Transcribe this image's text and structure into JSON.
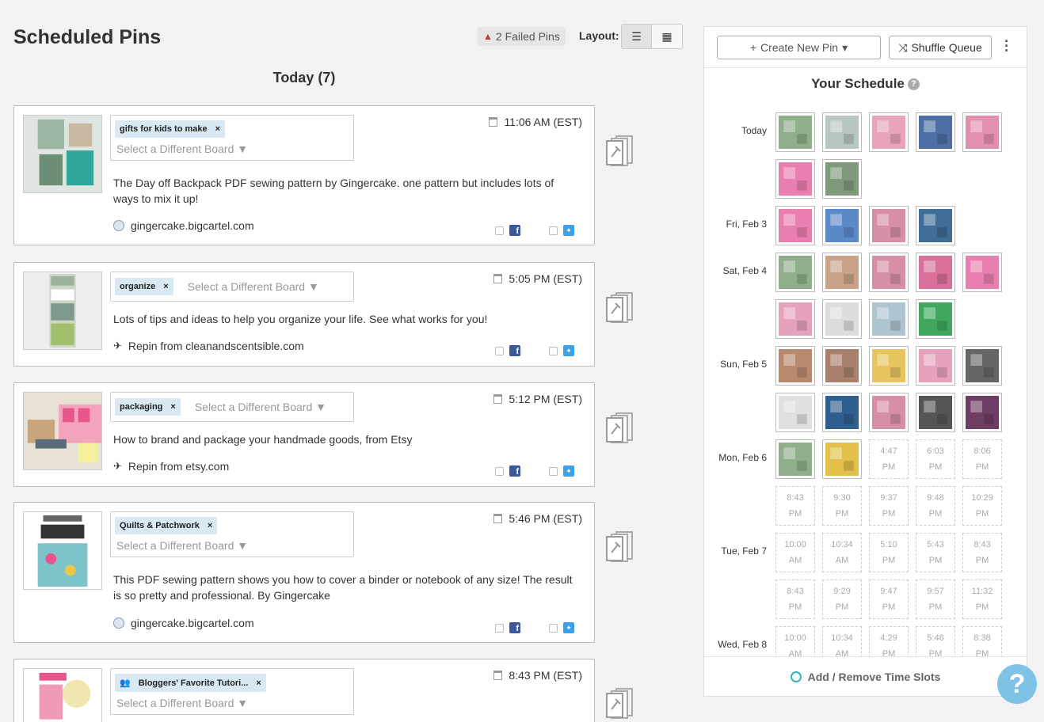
{
  "header": {
    "title": "Scheduled Pins",
    "failed_pins": "2 Failed Pins",
    "layout_label": "Layout:",
    "day_heading": "Today (7)"
  },
  "pins": [
    {
      "board": "gifts for kids to make",
      "board_select": "Select a Different Board ▼",
      "time": "11:06 AM (EST)",
      "description": "The Day off Backpack PDF sewing pattern by Gingercake.  one pattern but includes lots of ways to mix it up!",
      "source": "gingercake.bigcartel.com",
      "source_type": "web"
    },
    {
      "board": "organize",
      "board_select": "Select a Different Board ▼",
      "time": "5:05 PM (EST)",
      "description": "Lots of tips and ideas to help you organize your life. See what works for you!",
      "source": "Repin from cleanandscentsible.com",
      "source_type": "repin"
    },
    {
      "board": "packaging",
      "board_select": "Select a Different Board ▼",
      "time": "5:12 PM (EST)",
      "description": "How to brand and package your handmade goods, from Etsy",
      "source": "Repin from etsy.com",
      "source_type": "repin"
    },
    {
      "board": "Quilts & Patchwork",
      "board_select": "Select a Different Board ▼",
      "time": "5:46 PM (EST)",
      "description": "This PDF sewing pattern shows you how to cover a binder or notebook of any size!  The result is so pretty and professional.  By Gingercake",
      "source": "gingercake.bigcartel.com",
      "source_type": "web"
    },
    {
      "board": "Bloggers' Favorite Tutori...",
      "board_select": "Select a Different Board ▼",
      "time": "8:43 PM (EST)",
      "description": "",
      "source": "",
      "source_type": "none"
    }
  ],
  "panel": {
    "create_label": "Create New Pin",
    "shuffle_label": "Shuffle Queue",
    "schedule_title": "Your Schedule",
    "footer_label": "Add / Remove Time Slots",
    "days": [
      {
        "label": "Today",
        "rows": [
          [
            {
              "t": "img",
              "c": "#8fae8a"
            },
            {
              "t": "img",
              "c": "#b8c7c0"
            },
            {
              "t": "img",
              "c": "#e8a4b8"
            },
            {
              "t": "img",
              "c": "#4d6fa3"
            },
            {
              "t": "img",
              "c": "#e38fb0"
            }
          ],
          [
            {
              "t": "img",
              "c": "#e97fb0"
            },
            {
              "t": "img",
              "c": "#7f9a7a"
            }
          ]
        ]
      },
      {
        "label": "Fri, Feb 3",
        "rows": [
          [
            {
              "t": "img",
              "c": "#e97fb0"
            },
            {
              "t": "img",
              "c": "#5b8ac9"
            },
            {
              "t": "img",
              "c": "#d68fa4"
            },
            {
              "t": "img",
              "c": "#3e6d95"
            }
          ]
        ]
      },
      {
        "label": "Sat, Feb 4",
        "rows": [
          [
            {
              "t": "img",
              "c": "#8fae8a"
            },
            {
              "t": "img",
              "c": "#c9a28a"
            },
            {
              "t": "img",
              "c": "#d68fa4"
            },
            {
              "t": "img",
              "c": "#d8709a"
            },
            {
              "t": "img",
              "c": "#e97fb0"
            }
          ],
          [
            {
              "t": "img",
              "c": "#e6a2bd"
            },
            {
              "t": "img",
              "c": "#dddddd"
            },
            {
              "t": "img",
              "c": "#aec4cf"
            },
            {
              "t": "img",
              "c": "#3fa85c"
            }
          ]
        ]
      },
      {
        "label": "Sun, Feb 5",
        "rows": [
          [
            {
              "t": "img",
              "c": "#b9896e"
            },
            {
              "t": "img",
              "c": "#a8806b"
            },
            {
              "t": "img",
              "c": "#e7c45f"
            },
            {
              "t": "img",
              "c": "#e6a2bd"
            },
            {
              "t": "img",
              "c": "#666666"
            }
          ],
          [
            {
              "t": "img",
              "c": "#e0e0e0"
            },
            {
              "t": "img",
              "c": "#2f5f8f"
            },
            {
              "t": "img",
              "c": "#d68fa4"
            },
            {
              "t": "img",
              "c": "#555555"
            },
            {
              "t": "img",
              "c": "#6e3d63"
            }
          ]
        ]
      },
      {
        "label": "Mon, Feb 6",
        "rows": [
          [
            {
              "t": "img",
              "c": "#8fae8a"
            },
            {
              "t": "img",
              "c": "#e3c04a"
            },
            {
              "t": "slot",
              "a": "4:47",
              "b": "PM"
            },
            {
              "t": "slot",
              "a": "6:03",
              "b": "PM"
            },
            {
              "t": "slot",
              "a": "8:06",
              "b": "PM"
            }
          ],
          [
            {
              "t": "slot",
              "a": "8:43",
              "b": "PM"
            },
            {
              "t": "slot",
              "a": "9:30",
              "b": "PM"
            },
            {
              "t": "slot",
              "a": "9:37",
              "b": "PM"
            },
            {
              "t": "slot",
              "a": "9:48",
              "b": "PM"
            },
            {
              "t": "slot",
              "a": "10:29",
              "b": "PM"
            }
          ]
        ]
      },
      {
        "label": "Tue, Feb 7",
        "rows": [
          [
            {
              "t": "slot",
              "a": "10:00",
              "b": "AM"
            },
            {
              "t": "slot",
              "a": "10:34",
              "b": "AM"
            },
            {
              "t": "slot",
              "a": "5:10",
              "b": "PM"
            },
            {
              "t": "slot",
              "a": "5:43",
              "b": "PM"
            },
            {
              "t": "slot",
              "a": "8:43",
              "b": "PM"
            }
          ],
          [
            {
              "t": "slot",
              "a": "8:43",
              "b": "PM"
            },
            {
              "t": "slot",
              "a": "9:29",
              "b": "PM"
            },
            {
              "t": "slot",
              "a": "9:47",
              "b": "PM"
            },
            {
              "t": "slot",
              "a": "9:57",
              "b": "PM"
            },
            {
              "t": "slot",
              "a": "11:32",
              "b": "PM"
            }
          ]
        ]
      },
      {
        "label": "Wed, Feb 8",
        "rows": [
          [
            {
              "t": "slot",
              "a": "10:00",
              "b": "AM"
            },
            {
              "t": "slot",
              "a": "10:34",
              "b": "AM"
            },
            {
              "t": "slot",
              "a": "4:29",
              "b": "PM"
            },
            {
              "t": "slot",
              "a": "5:46",
              "b": "PM"
            },
            {
              "t": "slot",
              "a": "8:38",
              "b": "PM"
            }
          ]
        ]
      }
    ]
  },
  "help_label": "?"
}
